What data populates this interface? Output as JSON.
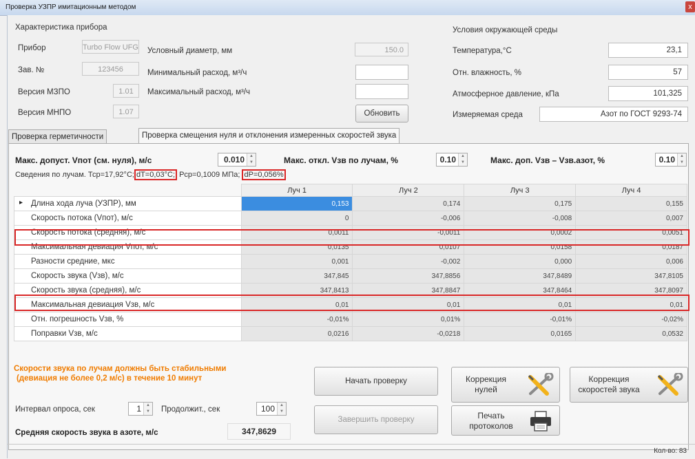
{
  "window": {
    "title": "Проверка УЗПР имитационным методом",
    "close": "x"
  },
  "device": {
    "section_title": "Характеристика прибора",
    "device_label": "Прибор",
    "device_value": "Turbo Flow UFG",
    "serial_label": "Зав. №",
    "serial_value": "123456",
    "mzpo_label": "Версия МЗПО",
    "mzpo_value": "1.01",
    "mnpo_label": "Версия МНПО",
    "mnpo_value": "1.07",
    "diameter_label": "Условный диаметр, мм",
    "diameter_value": "150.0",
    "minflow_label": "Минимальный расход, м³/ч",
    "minflow_value": "",
    "maxflow_label": "Максимальный расход, м³/ч",
    "maxflow_value": "",
    "update_button": "Обновить"
  },
  "env": {
    "section_title": "Условия окружающей среды",
    "temp_label": "Температура,°С",
    "temp_value": "23,1",
    "humidity_label": "Отн. влажность, %",
    "humidity_value": "57",
    "pressure_label": "Атмосферное давление, кПа",
    "pressure_value": "101,325",
    "medium_label": "Измеряемая среда",
    "medium_value": "Азот по ГОСТ 9293-74"
  },
  "tabs": [
    {
      "label": "Проверка герметичности"
    },
    {
      "label": "Проверка смещения нуля и отклонения измеренных скоростей звука"
    }
  ],
  "params": {
    "vpot_label": "Макс. допуст. Vпот (см. нуля), м/с",
    "vpot_value": "0.010",
    "beam_dev_label": "Макс. откл. Vзв по лучам, %",
    "beam_dev_value": "0.10",
    "nitrogen_label": "Макс. доп. Vзв – Vзв.азот, %",
    "nitrogen_value": "0.10",
    "info_prefix": "Сведения по лучам. Тср=17,92°С;",
    "dt": "dT=0,03°С;",
    "pcp": "Рср=0,1009 МПа;",
    "dp": "dP=0,056%"
  },
  "table": {
    "columns": [
      "Луч 1",
      "Луч 2",
      "Луч 3",
      "Луч 4"
    ],
    "current_row_marker": "▸",
    "rows": [
      {
        "label": "Длина хода луча (УЗПР), мм",
        "values": [
          "0,153",
          "0,174",
          "0,175",
          "0,155"
        ]
      },
      {
        "label": "Скорость потока (Vпот), м/с",
        "values": [
          "0",
          "-0,006",
          "-0,008",
          "0,007"
        ]
      },
      {
        "label": "Скорость потока (средняя), м/с",
        "values": [
          "0,0011",
          "-0,0011",
          "0,0002",
          "0,0051"
        ]
      },
      {
        "label": "Максимальная девиация Vпот, м/с",
        "values": [
          "0,0135",
          "0,0107",
          "0,0158",
          "0,0187"
        ]
      },
      {
        "label": "Разности средние, мкс",
        "values": [
          "0,001",
          "-0,002",
          "0,000",
          "0,006"
        ]
      },
      {
        "label": "Скорость звука (Vзв), м/с",
        "values": [
          "347,845",
          "347,8856",
          "347,8489",
          "347,8105"
        ]
      },
      {
        "label": "Скорость звука (средняя), м/с",
        "values": [
          "347,8413",
          "347,8847",
          "347,8464",
          "347,8097"
        ]
      },
      {
        "label": "Максимальная девиация Vзв, м/с",
        "values": [
          "0,01",
          "0,01",
          "0,01",
          "0,01"
        ]
      },
      {
        "label": "Отн. погрешность Vзв, %",
        "values": [
          "-0,01%",
          "0,01%",
          "-0,01%",
          "-0,02%"
        ]
      },
      {
        "label": "Поправки Vзв, м/с",
        "values": [
          "0,0216",
          "-0,0218",
          "0,0165",
          "0,0532"
        ]
      }
    ]
  },
  "bottom": {
    "warning_line1": "Скорости звука по лучам должны быть стабильными",
    "warning_line2": "(девиация не более 0,2 м/с) в течение 10 минут",
    "interval_label": "Интервал опроса, сек",
    "interval_value": "1",
    "duration_label": "Продолжит., сек",
    "duration_value": "100",
    "avg_label": "Средняя скорость звука в азоте, м/с",
    "avg_value": "347,8629",
    "start_button": "Начать проверку",
    "finish_button": "Завершить проверку",
    "zero_corr_line1": "Коррекция",
    "zero_corr_line2": "нулей",
    "speed_corr_line1": "Коррекция",
    "speed_corr_line2": "скоростей звука",
    "print_line1": "Печать",
    "print_line2": "протоколов"
  },
  "status": {
    "count": "Кол-во: 83"
  },
  "colors": {
    "highlight": "#d92626",
    "selection": "#3b8de0",
    "warning": "#f07c00"
  }
}
